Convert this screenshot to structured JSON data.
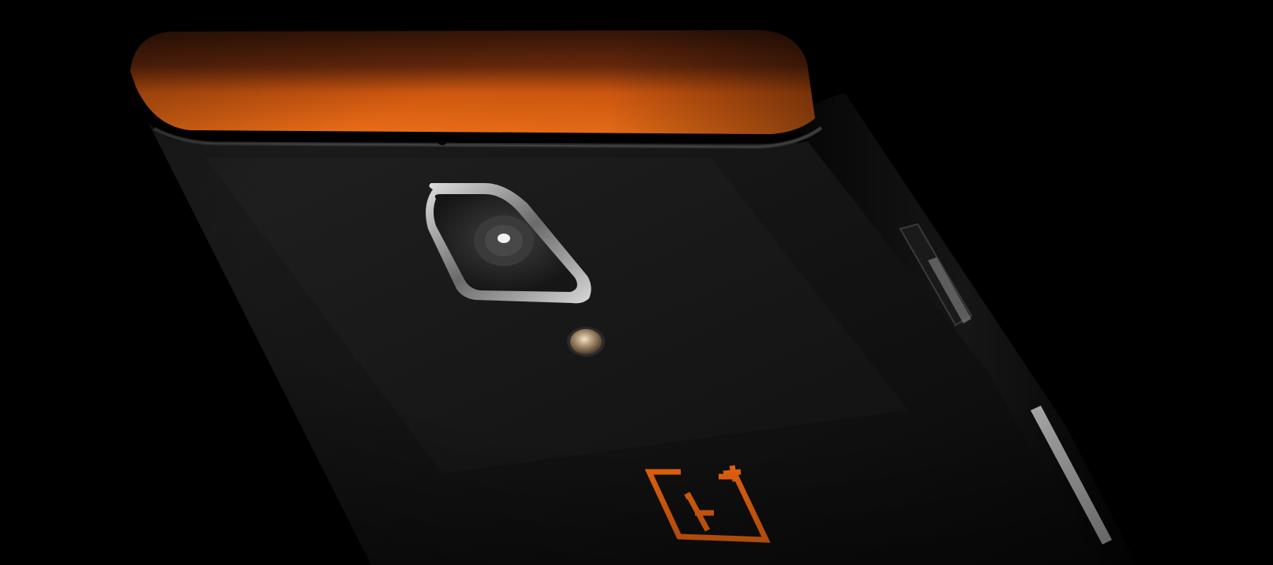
{
  "scene": {
    "subject": "smartphone-rear-view",
    "background_color": "#000000",
    "body_color": "#141414",
    "accent_color": "#ef6a12",
    "logo": {
      "icon": "oneplus-logo-icon",
      "color": "#e8630f"
    },
    "camera": {
      "icon": "camera-lens-icon"
    },
    "flash": {
      "icon": "flash-icon"
    }
  }
}
